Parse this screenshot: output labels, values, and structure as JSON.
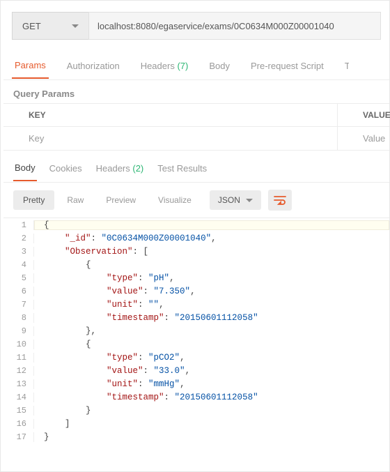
{
  "request": {
    "method": "GET",
    "url": "localhost:8080/egaservice/exams/0C0634M000Z00001040"
  },
  "reqTabs": {
    "params": "Params",
    "auth": "Authorization",
    "headers": "Headers",
    "headersCount": "(7)",
    "body": "Body",
    "preReq": "Pre-request Script",
    "tests": "T"
  },
  "queryParams": {
    "title": "Query Params",
    "keyHeader": "KEY",
    "valueHeader": "VALUE",
    "keyPlaceholder": "Key",
    "valuePlaceholder": "Value"
  },
  "respTabs": {
    "body": "Body",
    "cookies": "Cookies",
    "headers": "Headers",
    "headersCount": "(2)",
    "tests": "Test Results"
  },
  "viewer": {
    "pretty": "Pretty",
    "raw": "Raw",
    "preview": "Preview",
    "visualize": "Visualize",
    "lang": "JSON"
  },
  "body": {
    "idKey": "\"_id\"",
    "idVal": "\"0C0634M000Z00001040\"",
    "obsKey": "\"Observation\"",
    "typeKey": "\"type\"",
    "valueKey": "\"value\"",
    "unitKey": "\"unit\"",
    "tsKey": "\"timestamp\"",
    "o1": {
      "type": "\"pH\"",
      "value": "\"7.350\"",
      "unit": "\"\"",
      "ts": "\"20150601112058\""
    },
    "o2": {
      "type": "\"pCO2\"",
      "value": "\"33.0\"",
      "unit": "\"mmHg\"",
      "ts": "\"20150601112058\""
    }
  }
}
